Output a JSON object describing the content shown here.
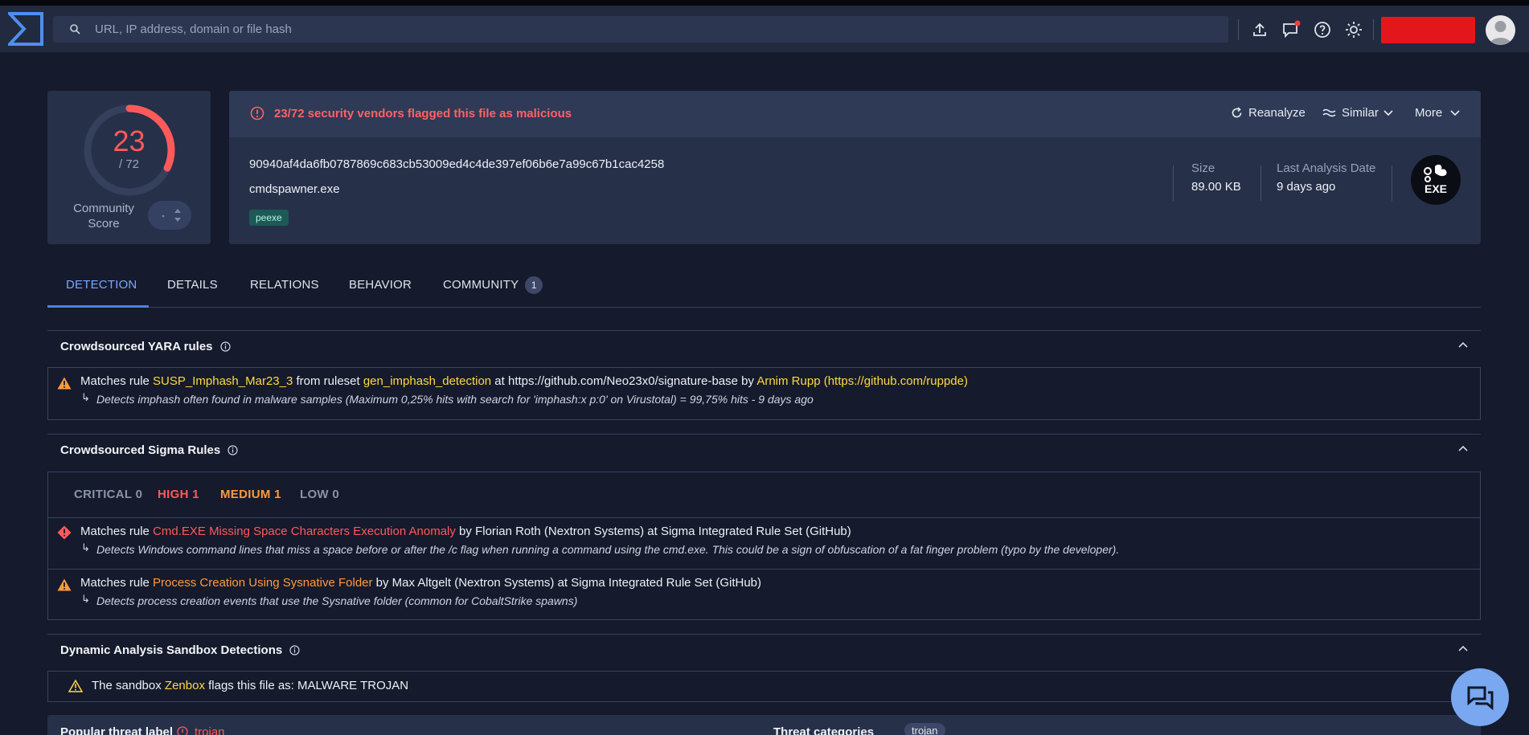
{
  "search": {
    "placeholder": "URL, IP address, domain or file hash"
  },
  "score": {
    "value": "23",
    "total": "/ 72",
    "community_label_1": "Community",
    "community_label_2": "Score",
    "fraction_flagged": 0.3194
  },
  "alert": {
    "text": "23/72 security vendors flagged this file as malicious"
  },
  "actions": {
    "reanalyze": "Reanalyze",
    "similar": "Similar",
    "more": "More"
  },
  "file": {
    "hash": "90940af4da6fb0787869c683cb53009ed4c4de397ef06b6e7a99c67b1cac4258",
    "name": "cmdspawner.exe",
    "tag": "peexe",
    "size_label": "Size",
    "size_value": "89.00 KB",
    "date_label": "Last Analysis Date",
    "date_value": "9 days ago",
    "type_label": "EXE"
  },
  "tabs": [
    {
      "label": "DETECTION"
    },
    {
      "label": "DETAILS"
    },
    {
      "label": "RELATIONS"
    },
    {
      "label": "BEHAVIOR"
    },
    {
      "label": "COMMUNITY",
      "badge": "1"
    }
  ],
  "yara": {
    "title": "Crowdsourced YARA rules",
    "m1": "Matches rule ",
    "rule": "SUSP_Imphash_Mar23_3",
    "m2": " from ruleset ",
    "ruleset": "gen_imphash_detection",
    "m3": " at https://github.com/Neo23x0/signature-base by ",
    "author": "Arnim Rupp (https://github.com/ruppde)",
    "desc": "Detects imphash often found in malware samples (Maximum 0,25% hits with search for 'imphash:x p:0' on Virustotal) = 99,75% hits - 9 days ago"
  },
  "sigma": {
    "title": "Crowdsourced Sigma Rules",
    "critical": "CRITICAL 0",
    "high": "HIGH 1",
    "medium": "MEDIUM 1",
    "low": "LOW 0",
    "r1_prefix": "Matches rule ",
    "r1_rule": "Cmd.EXE Missing Space Characters Execution Anomaly",
    "r1_suffix": " by Florian Roth (Nextron Systems) at Sigma Integrated Rule Set (GitHub)",
    "r1_desc": "Detects Windows command lines that miss a space before or after the /c flag when running a command using the cmd.exe. This could be a sign of obfuscation of a fat finger problem (typo by the developer).",
    "r2_prefix": "Matches rule ",
    "r2_rule": "Process Creation Using Sysnative Folder",
    "r2_suffix": " by Max Altgelt (Nextron Systems) at Sigma Integrated Rule Set (GitHub)",
    "r2_desc": "Detects process creation events that use the Sysnative folder (common for CobaltStrike spawns)"
  },
  "sandbox": {
    "title": "Dynamic Analysis Sandbox Detections",
    "p1": "The sandbox ",
    "name": "Zenbox",
    "p2": " flags this file as: MALWARE TROJAN"
  },
  "threat": {
    "label_key": "Popular threat label",
    "label_value": "trojan",
    "cat_key": "Threat categories",
    "cat_value": "trojan"
  },
  "colors": {
    "accent": "#4f7fe6",
    "danger": "#ff5a5a",
    "warning": "#ff9a3d",
    "highlight": "#ffd93e"
  }
}
